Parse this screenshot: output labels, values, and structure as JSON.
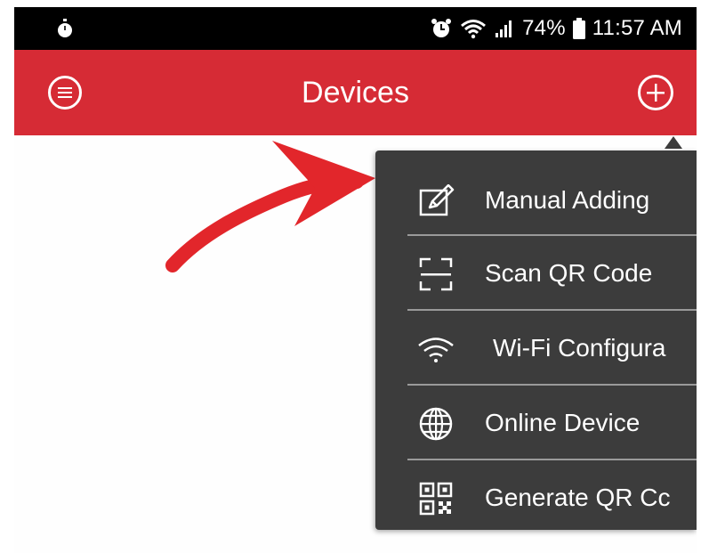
{
  "status_bar": {
    "battery_text": "74%",
    "time_text": "11:57 AM",
    "left_icon": "stopwatch-icon",
    "right_icons": [
      "alarm-icon",
      "wifi-icon",
      "signal-icon",
      "battery-icon"
    ]
  },
  "header": {
    "title": "Devices",
    "menu_icon": "menu-icon",
    "add_icon": "plus-icon",
    "accent_color": "#d62b35"
  },
  "menu": {
    "items": [
      {
        "label": "Manual Adding",
        "icon": "edit-icon"
      },
      {
        "label": "Scan QR Code",
        "icon": "scan-icon"
      },
      {
        "label": "Wi-Fi Configura",
        "icon": "wifi-icon"
      },
      {
        "label": "Online Device",
        "icon": "globe-icon"
      },
      {
        "label": "Generate QR Cc",
        "icon": "qr-code-icon"
      }
    ],
    "background_color": "#3c3c3c"
  },
  "annotation": {
    "icon": "red-arrow-icon",
    "color": "#e2262b"
  }
}
